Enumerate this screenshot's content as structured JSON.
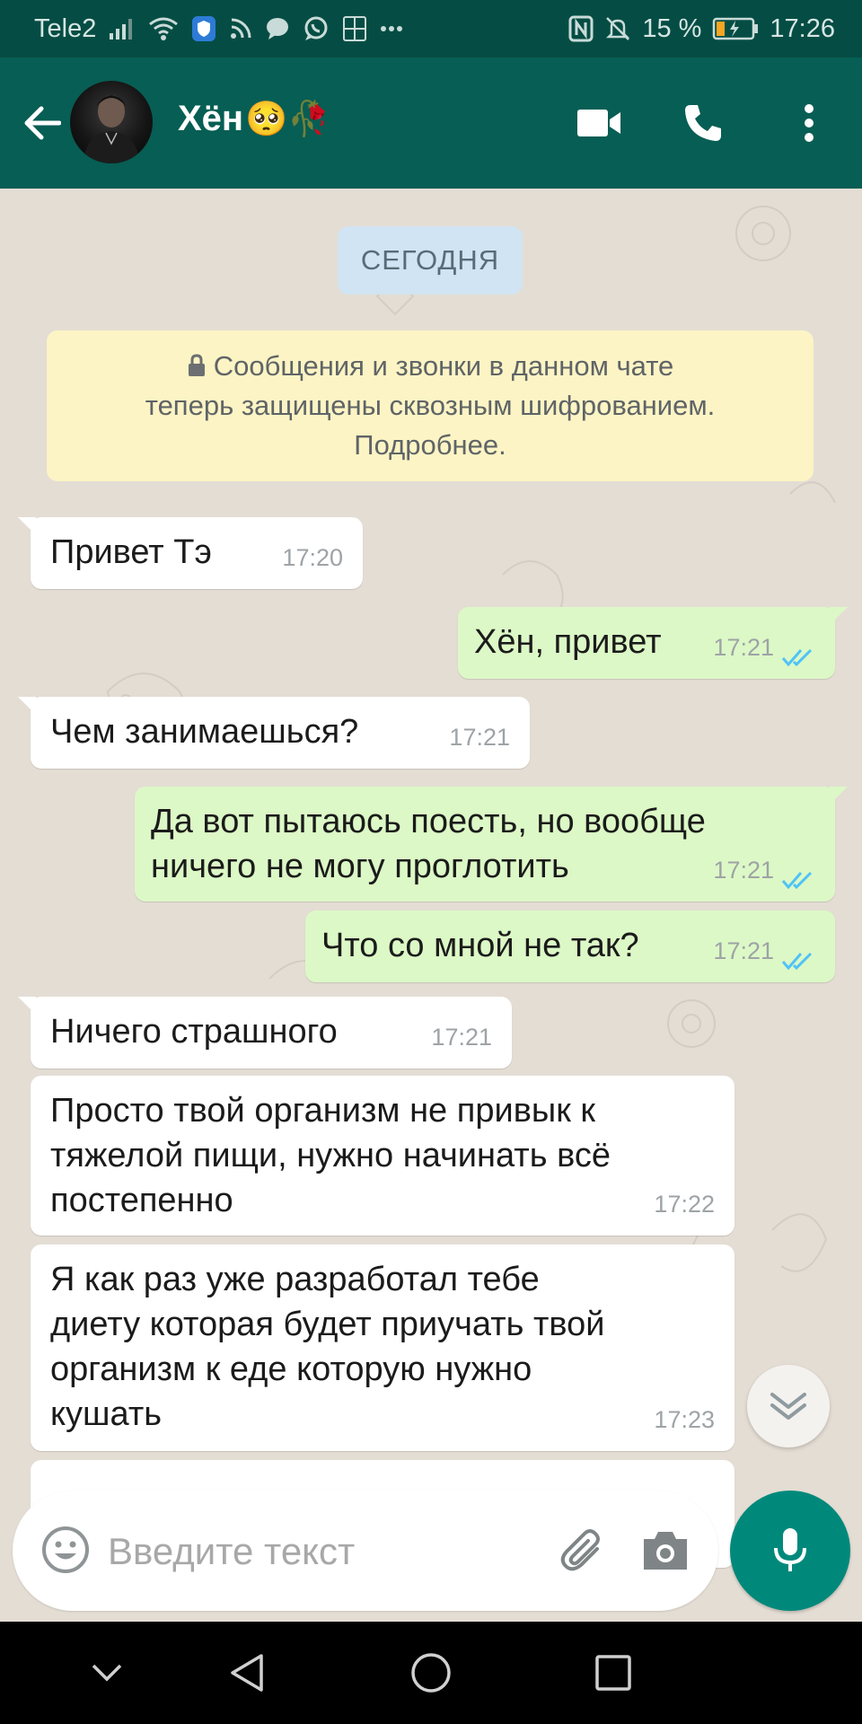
{
  "status_bar": {
    "carrier": "Tele2",
    "battery_percent": "15 %",
    "time": "17:26"
  },
  "header": {
    "contact_name": "Хён",
    "contact_emojis": "🥺🥀"
  },
  "chat": {
    "date_label": "СЕГОДНЯ",
    "encryption_notice": "Сообщения и звонки в данном чате\nтеперь защищены сквозным шифрованием.\nПодробнее.",
    "messages": [
      {
        "direction": "in",
        "text": "Привет Тэ",
        "time": "17:20"
      },
      {
        "direction": "out",
        "text": "Хён, привет",
        "time": "17:21",
        "status": "read"
      },
      {
        "direction": "in",
        "text": "Чем занимаешься?",
        "time": "17:21"
      },
      {
        "direction": "out",
        "text": "Да вот пытаюсь поесть, но вообще\nничего не могу проглотить",
        "time": "17:21",
        "status": "read"
      },
      {
        "direction": "out",
        "text": "Что со мной не так?",
        "time": "17:21",
        "status": "read"
      },
      {
        "direction": "in",
        "text": "Ничего страшного",
        "time": "17:21"
      },
      {
        "direction": "in",
        "text": "Просто твой организм не привык к\nтяжелой пищи, нужно начинать всё\nпостепенно",
        "time": "17:22"
      },
      {
        "direction": "in",
        "text": "Я как раз уже разработал тебе\nдиету которая будет приучать твой\nорганизм к еде которую нужно\nкушать",
        "time": "17:23"
      }
    ]
  },
  "composer": {
    "placeholder": "Введите текст"
  },
  "colors": {
    "header": "#075e54",
    "status_bar": "#054d44",
    "outgoing_bubble": "#dcf8c6",
    "incoming_bubble": "#ffffff",
    "accent": "#00897b",
    "read_ticks": "#4fc3f7"
  },
  "icons": {
    "back": "arrow-left",
    "video_call": "video-camera",
    "voice_call": "phone",
    "menu": "more-vertical",
    "emoji": "smiley-face",
    "attach": "paperclip",
    "camera": "camera",
    "mic": "microphone",
    "scroll_down": "double-chevron-down"
  }
}
